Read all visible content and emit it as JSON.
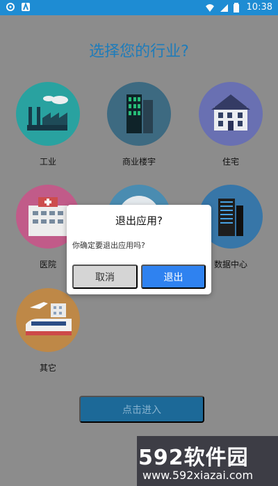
{
  "status": {
    "time": "10:38"
  },
  "title": "选择您的行业?",
  "industries": [
    {
      "label": "工业",
      "color": "#2aa6a4"
    },
    {
      "label": "商业楼宇",
      "color": "#3f6d84"
    },
    {
      "label": "住宅",
      "color": "#6c73b6"
    },
    {
      "label": "医院",
      "color": "#c55d8c"
    },
    {
      "label": "",
      "color": "#4c8fb5"
    },
    {
      "label": "数据中心",
      "color": "#3979ac"
    },
    {
      "label": "其它",
      "color": "#c28b49"
    }
  ],
  "enter_label": "点击进入",
  "dialog": {
    "title": "退出应用?",
    "message": "你确定要退出应用吗?",
    "cancel": "取消",
    "confirm": "退出"
  },
  "watermark": {
    "brand": "592软件园",
    "url": "www.592xiazai.com"
  }
}
